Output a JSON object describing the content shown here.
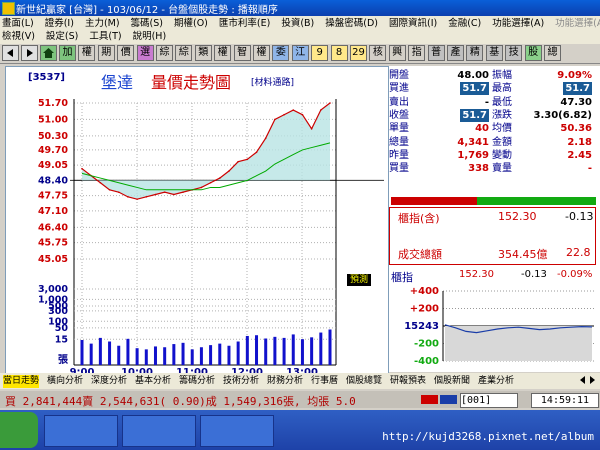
{
  "window": {
    "title": "新世紀贏家 [台灣] - 103/06/12 - 台盤個股走勢 : 播報順序"
  },
  "menu": {
    "row1": [
      "畫面(L)",
      "證券(I)",
      "主力(M)",
      "籌碼(S)",
      "期權(O)",
      "匯市利率(E)",
      "投資(B)",
      "操盤密碼(D)",
      "國際資訊(I)",
      "金融(C)",
      "功能選擇(A)",
      "功能選擇(A)"
    ],
    "row2": [
      "檢視(V)",
      "設定(S)",
      "工具(T)",
      "說明(H)"
    ]
  },
  "toolbar": {
    "buttons": [
      "加",
      "權",
      "期",
      "價",
      "選",
      "綜",
      "綜",
      "類",
      "權",
      "智",
      "權",
      "委",
      "江",
      "9",
      "8",
      "29",
      "核",
      "興",
      "指",
      "普",
      "產",
      "精",
      "基",
      "技",
      "股",
      "總"
    ]
  },
  "chart": {
    "stock_code": "[3537]",
    "stock_name": "堡達",
    "chart_title": "量價走勢圖",
    "source_label": "[材料通路]",
    "predict_label": "預測",
    "volume_axis_unit": "張",
    "price_ticks": [
      "51.70",
      "51.00",
      "50.30",
      "49.70",
      "49.05",
      "48.40",
      "47.75",
      "47.10",
      "46.40",
      "45.75",
      "45.05"
    ],
    "price_ref": "48.40",
    "volume_ticks": [
      "3,000",
      "1,000",
      "500",
      "300",
      "100",
      "50",
      "15"
    ],
    "time_ticks": [
      "9:00",
      "10:00",
      "11:00",
      "12:00",
      "13:00"
    ]
  },
  "chart_data": {
    "type": "line",
    "title": "量價走勢圖",
    "xlabel": "",
    "ylabel": "",
    "ylim": [
      45.05,
      51.7
    ],
    "x": [
      "9:00",
      "9:10",
      "9:20",
      "9:30",
      "9:40",
      "9:50",
      "10:00",
      "10:10",
      "10:20",
      "10:30",
      "10:40",
      "10:50",
      "11:00",
      "11:10",
      "11:20",
      "11:30",
      "11:40",
      "11:50",
      "12:00",
      "12:10",
      "12:20",
      "12:30",
      "12:40",
      "12:50",
      "13:00",
      "13:10",
      "13:20",
      "13:30"
    ],
    "series": [
      {
        "values": [
          48.9,
          48.6,
          48.3,
          48.0,
          47.9,
          47.7,
          47.6,
          47.7,
          47.8,
          47.9,
          47.8,
          47.9,
          48.0,
          48.1,
          48.3,
          48.5,
          48.8,
          49.2,
          49.3,
          49.6,
          50.2,
          51.0,
          51.2,
          51.4,
          51.2,
          50.6,
          51.4,
          51.7
        ]
      },
      {
        "values": [
          48.7,
          48.6,
          48.5,
          48.4,
          48.3,
          48.2,
          48.1,
          48.0,
          48.0,
          48.0,
          48.0,
          48.0,
          48.0,
          48.0,
          48.1,
          48.1,
          48.2,
          48.3,
          48.4,
          48.6,
          48.8,
          49.1,
          49.3,
          49.5,
          49.7,
          49.8,
          49.9,
          50.0
        ]
      }
    ],
    "volume": [
      120,
      60,
      180,
      90,
      40,
      150,
      25,
      20,
      35,
      30,
      55,
      70,
      20,
      30,
      45,
      60,
      40,
      90,
      260,
      300,
      160,
      220,
      180,
      350,
      140,
      200,
      500,
      900
    ],
    "volume_ticks": [
      3000,
      1000,
      500,
      300,
      100,
      50,
      15
    ]
  },
  "quote": {
    "rows": [
      {
        "l1": "開盤",
        "v1": "48.00",
        "l2": "振幅",
        "v2": "9.09%",
        "v2color": "#cc0000"
      },
      {
        "l1": "買進",
        "v1": "51.7",
        "v1box": true,
        "l2": "最高",
        "v2": "51.7",
        "v2box": true
      },
      {
        "l1": "賣出",
        "v1": "-",
        "l2": "最低",
        "v2": "47.30"
      },
      {
        "l1": "收盤",
        "v1": "51.7",
        "v1box": true,
        "l2": "漲跌",
        "v2": "3.30(6.82)"
      },
      {
        "l1": "單量",
        "v1": "40",
        "l2": "均價",
        "v2": "50.36"
      },
      {
        "l1": "總量",
        "v1": "4,341",
        "l2": "金額",
        "v2": "2.18"
      },
      {
        "l1": "昨量",
        "v1": "1,769",
        "l2": "變動",
        "v2": "2.45"
      },
      {
        "l1": "買量",
        "v1": "338",
        "l2": "賣量",
        "v2": "-"
      }
    ],
    "ratio_bar": {
      "red": 0.42,
      "green": 0.58
    }
  },
  "index": {
    "cash_label": "櫃指(含)",
    "cash_value": "152.30",
    "cash_change": "-0.13",
    "trade_label": "成交總額",
    "trade_value": "354.45億",
    "trade_change": "22.8",
    "mini_label": "櫃指",
    "mini_value": "152.30",
    "mini_change": "-0.13",
    "mini_pct": "-0.09%",
    "mini_ticks": [
      "+400",
      "+200",
      "15243",
      "-200",
      "-400"
    ]
  },
  "tabs": [
    "當日走勢",
    "橫向分析",
    "深度分析",
    "基本分析",
    "籌碼分析",
    "技術分析",
    "財務分析",
    "行事曆",
    "個股總覽",
    "研報預表",
    "個股新聞",
    "產業分析"
  ],
  "status": {
    "text": "買 2,841,444賣 2,544,631( 0.90)成 1,549,316張, 均張 5.0",
    "code": "001",
    "time": "14:59:11"
  },
  "taskbar": {
    "url": "http://kujd3268.pixnet.net/album"
  },
  "colors": {
    "price_line": "#cc0000",
    "avg_line": "#00aa00",
    "volume_bar": "#1111cc",
    "grid": "#b0b0b0",
    "panel_bg": "#ffffff"
  }
}
